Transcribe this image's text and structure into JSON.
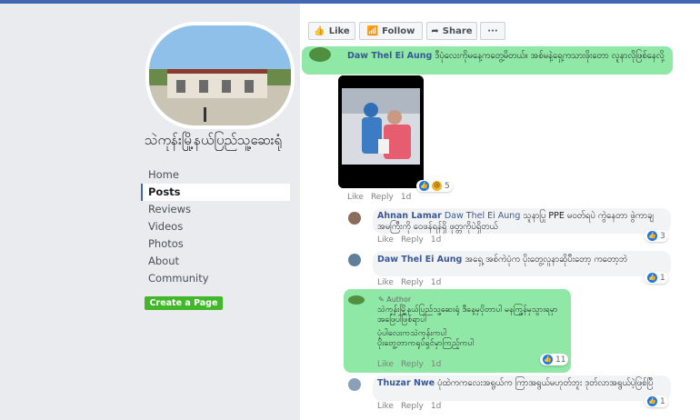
{
  "sidebar": {
    "page_name": "သဲကုန်းမြို့နယ်ပြည်သူ့ဆေးရုံ",
    "nav": [
      "Home",
      "Posts",
      "Reviews",
      "Videos",
      "Photos",
      "About",
      "Community"
    ],
    "create_page": "Create a Page"
  },
  "actions": {
    "like": "Like",
    "follow": "Follow",
    "share": "Share",
    "more": "···"
  },
  "comments": [
    {
      "author": "Daw Thel Ei Aung",
      "text": "ဒီပုံလေးကိုမနေ့ကတွေ့မိတယ်။ အစ်မနဲ့ရှေ့ကသားဖိုးတော လူနာလိုဖြစ်နေလို့"
    },
    {
      "reactions": "5",
      "like": "Like",
      "reply": "Reply",
      "time": "1d"
    },
    {
      "author": "Ahnan Lamar",
      "mention": "Daw Thel Ei Aung",
      "text": "သူနာပြု PPE မဝတ်ရပဲ ကွဲနေတာ ဖွဲကာချ အမကြီးကို ဝေဖန်ရန်ရှိ ဖုတ္တကိုပဲရှိတယ်",
      "reactions": "3",
      "like": "Like",
      "reply": "Reply",
      "time": "1d"
    },
    {
      "author": "Daw Thel Ei Aung",
      "text": "အရှေ့ အစ်ကဲပုံက ပိုးတွေ့လူနာဆိုပီးတော့ ကတော့ဘဲ",
      "reactions": "1",
      "like": "Like",
      "reply": "Reply",
      "time": "1d"
    },
    {
      "badge": "Author",
      "text1": "သဲကုန်းမြို့နယ်ပြည်သူ့ဆေးရုံ ဒီနေ့မှပိုတာပါ မနက္ဖြန်မှသွားရမှာ",
      "text2": "အဖြေပါဖြစ်ရာပါ",
      "text3": "ပုံပါလေးကသဲကုန်းကပါ",
      "text4": "ပိုးတွေ့တာကရုပ်ရှင်မှာကြည့်ကပါ",
      "reactions": "11",
      "like": "Like",
      "reply": "Reply",
      "time": "1d"
    },
    {
      "author": "Thuzar Nwe",
      "text": "ပုံထဲကကလေးအရွယ်က ကြာအရွယ်မဟုတ်ဘူး ဒုတ်လာအရွယ်ပဲ့ဖြစ်ပြီ",
      "reactions": "1",
      "like": "Like",
      "reply": "Reply",
      "time": "1d"
    }
  ],
  "colors": {
    "link": "#385898",
    "highlight": "#7be495",
    "brand": "#4267b2",
    "create": "#42b72a"
  }
}
